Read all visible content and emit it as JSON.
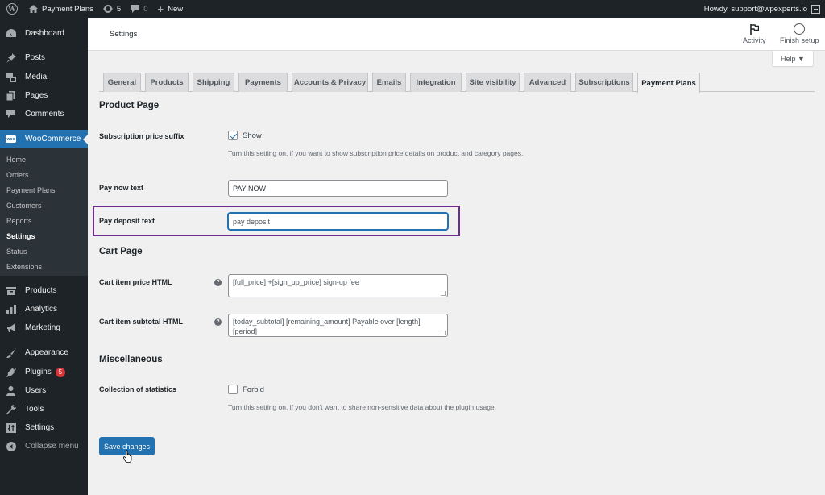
{
  "adminbar": {
    "wp_logo": "W",
    "site_name": "Payment Plans",
    "updates_count": "5",
    "comments_count": "0",
    "new_label": "New",
    "howdy": "Howdy, support@wpexperts.io"
  },
  "sidebar": {
    "items": [
      {
        "label": "Dashboard",
        "icon": "dashboard-icon"
      },
      {
        "label": "Posts",
        "icon": "pin-icon"
      },
      {
        "label": "Media",
        "icon": "media-icon"
      },
      {
        "label": "Pages",
        "icon": "pages-icon"
      },
      {
        "label": "Comments",
        "icon": "comment-icon"
      },
      {
        "label": "WooCommerce",
        "icon": "woo-icon"
      },
      {
        "label": "Products",
        "icon": "archive-icon"
      },
      {
        "label": "Analytics",
        "icon": "bar-chart-icon"
      },
      {
        "label": "Marketing",
        "icon": "megaphone-icon"
      },
      {
        "label": "Appearance",
        "icon": "paintbrush-icon"
      },
      {
        "label": "Plugins",
        "icon": "plug-icon",
        "badge": "5"
      },
      {
        "label": "Users",
        "icon": "user-icon"
      },
      {
        "label": "Tools",
        "icon": "wrench-icon"
      },
      {
        "label": "Settings",
        "icon": "sliders-icon"
      },
      {
        "label": "Collapse menu",
        "icon": "collapse-icon"
      }
    ],
    "woo_icon_text": "woo",
    "submenu": [
      "Home",
      "Orders",
      "Payment Plans",
      "Customers",
      "Reports",
      "Settings",
      "Status",
      "Extensions"
    ],
    "current_submenu": "Settings"
  },
  "header": {
    "title": "Settings",
    "activity": "Activity",
    "finish_setup": "Finish setup",
    "help": "Help ▼"
  },
  "tabs": [
    "General",
    "Products",
    "Shipping",
    "Payments",
    "Accounts & Privacy",
    "Emails",
    "Integration",
    "Site visibility",
    "Advanced",
    "Subscriptions",
    "Payment Plans"
  ],
  "active_tab": "Payment Plans",
  "sections": {
    "product_page": {
      "heading": "Product Page",
      "suffix_label": "Subscription price suffix",
      "suffix_checkbox": "Show",
      "suffix_checked": true,
      "suffix_desc": "Turn this setting on, if you want to show subscription price details on product and category pages.",
      "pay_now_label": "Pay now text",
      "pay_now_value": "PAY NOW",
      "pay_deposit_label": "Pay deposit text",
      "pay_deposit_value": "pay deposit"
    },
    "cart_page": {
      "heading": "Cart Page",
      "price_label": "Cart item price HTML",
      "price_value": "[full_price] +[sign_up_price] sign-up fee",
      "subtotal_label": "Cart item subtotal HTML",
      "subtotal_value": "[today_subtotal] [remaining_amount] Payable over [length] [period]",
      "help_tip": "?"
    },
    "misc": {
      "heading": "Miscellaneous",
      "stats_label": "Collection of statistics",
      "stats_checkbox": "Forbid",
      "stats_checked": false,
      "stats_desc": "Turn this setting on, if you don't want to share non-sensitive data about the plugin usage."
    }
  },
  "save_label": "Save changes",
  "colors": {
    "accent": "#2271b1",
    "highlight": "#6e2b8f",
    "sidebar_bg": "#1d2327",
    "badge": "#d63638"
  }
}
